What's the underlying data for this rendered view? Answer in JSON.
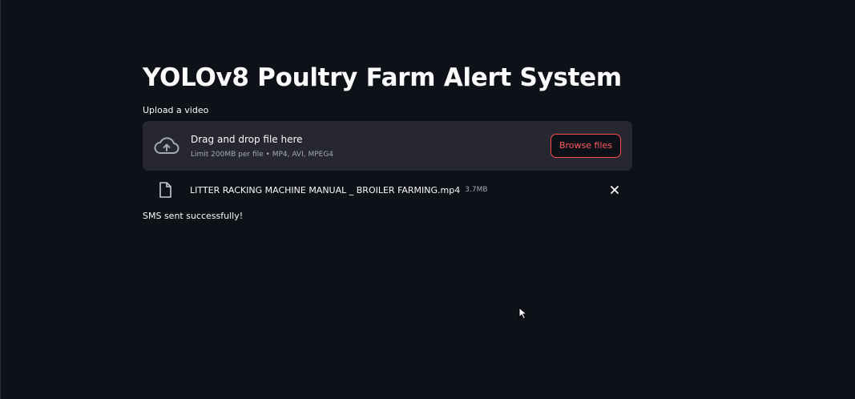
{
  "header": {
    "title": "YOLOv8 Poultry Farm Alert System"
  },
  "uploader": {
    "label": "Upload a video",
    "dropzone_title": "Drag and drop file here",
    "dropzone_limit": "Limit 200MB per file • MP4, AVI, MPEG4",
    "browse_label": "Browse files",
    "icon": "cloud-upload-icon"
  },
  "uploaded_file": {
    "name": "LITTER RACKING MACHINE MANUAL _ BROILER FARMING.mp4",
    "size": "3.7MB",
    "icon": "file-icon",
    "remove_icon": "close-icon"
  },
  "status": {
    "message": "SMS sent successfully!"
  },
  "colors": {
    "background": "#0e1117",
    "dropzone": "#262730",
    "accent": "#ff4b4b",
    "text": "#fafafa",
    "muted": "#a3a8b8"
  }
}
